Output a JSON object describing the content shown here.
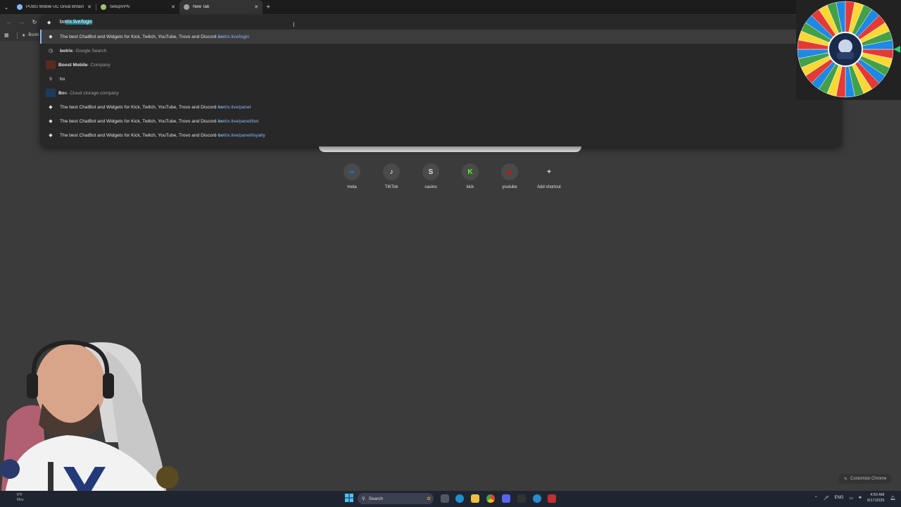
{
  "tabs": [
    {
      "title": "PUBG Mobile UC Great Britain |",
      "favicon_color": "#8ab4f8",
      "active": false
    },
    {
      "title": "SetupVPN",
      "favicon_color": "#a0c070",
      "active": false
    },
    {
      "title": "New Tab",
      "favicon_color": "#9aa0a6",
      "active": true
    }
  ],
  "tab_close_glyph": "✕",
  "new_tab_glyph": "+",
  "bookmarks_label": "Booki",
  "omnibox": {
    "typed": "bo",
    "completion": "trix.live/login",
    "suggestions": [
      {
        "icon": "diamond",
        "title": "The best ChatBot and Widgets for Kick, Twitch, YouTube, Trovo and Discord",
        "sep": " - ",
        "url_bold": "bo",
        "url_rest": "trix.live/login",
        "selected": true
      },
      {
        "icon": "history",
        "bold": "bo",
        "rest": "trix",
        "desc": " - Google Search"
      },
      {
        "icon": "square",
        "color": "#5a2a20",
        "bold": "Bo",
        "rest": "ost Mobile",
        "desc": " - Company"
      },
      {
        "icon": "search",
        "bold": "",
        "rest": "bo",
        "desc": ""
      },
      {
        "icon": "square",
        "color": "#1e3a5a",
        "bold": "Bo",
        "rest": "x",
        "desc": " - Cloud storage company"
      },
      {
        "icon": "diamond",
        "title": "The best ChatBot and Widgets for Kick, Twitch, YouTube, Trovo and Discord",
        "sep": " - ",
        "url_bold": "bo",
        "url_rest": "trix.live/panel"
      },
      {
        "icon": "diamond",
        "title": "The best ChatBot and Widgets for Kick, Twitch, YouTube, Trovo and Discord",
        "sep": " - ",
        "url_bold": "bo",
        "url_rest": "trix.live/panel/bot"
      },
      {
        "icon": "diamond",
        "title": "The best ChatBot and Widgets for Kick, Twitch, YouTube, Trovo and Discord",
        "sep": " - ",
        "url_bold": "bo",
        "url_rest": "trix.live/panel/loyalty"
      }
    ]
  },
  "shortcuts": [
    {
      "label": "meta",
      "glyph": "∞",
      "color": "#1877f2"
    },
    {
      "label": "TIKTok",
      "glyph": "♪",
      "color": "#ffffff"
    },
    {
      "label": "casino",
      "glyph": "S",
      "color": "#e0e0e0"
    },
    {
      "label": "kick",
      "glyph": "K",
      "color": "#53fc18"
    },
    {
      "label": "youtube",
      "glyph": "▶",
      "color": "#ff0000"
    },
    {
      "label": "Add shortcut",
      "glyph": "+",
      "color": "#e0e0e0"
    }
  ],
  "customize_label": "Customize Chrome",
  "taskbar": {
    "search_label": "Search",
    "language": "ENG",
    "time": "4:50 AM",
    "date": "9/17/2025",
    "left_text_1": "8°F",
    "left_text_2": "Mos"
  },
  "wheel_colors": [
    "#e53935",
    "#fdd835",
    "#43a047",
    "#1e88e5"
  ]
}
